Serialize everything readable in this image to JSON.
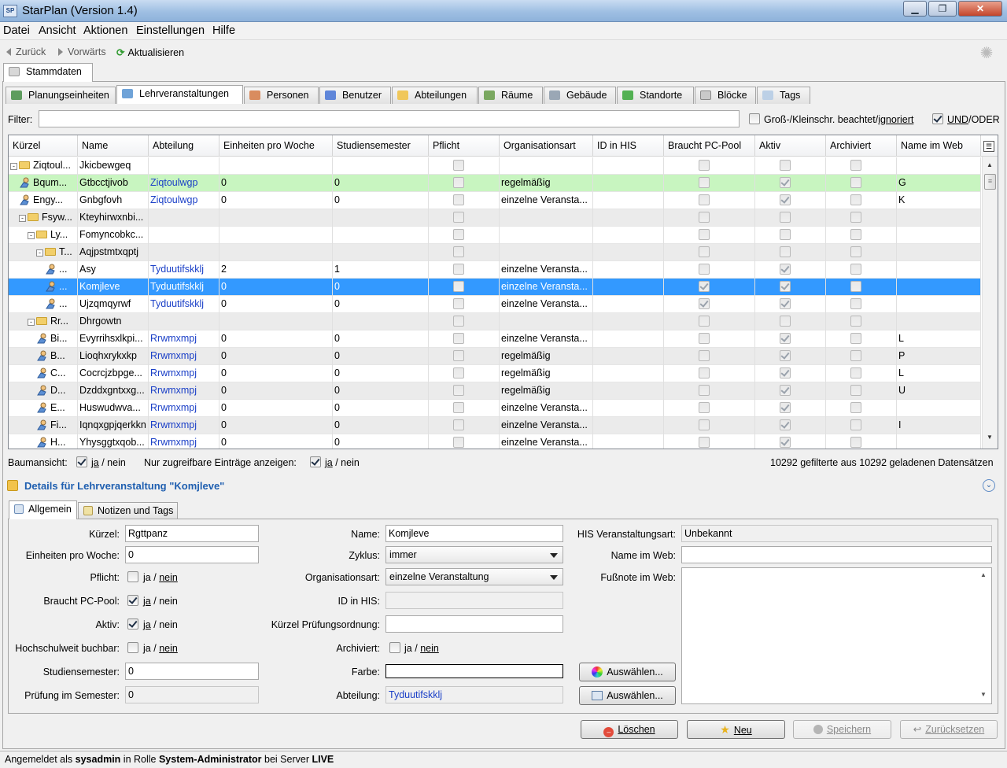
{
  "window": {
    "title": "StarPlan (Version 1.4)",
    "app_icon": "SP"
  },
  "menu": [
    "Datei",
    "Ansicht",
    "Aktionen",
    "Einstellungen",
    "Hilfe"
  ],
  "nav": {
    "back": "Zurück",
    "forward": "Vorwärts",
    "refresh": "Aktualisieren"
  },
  "outer_tab": "Stammdaten",
  "tabs": [
    "Planungseinheiten",
    "Lehrveranstaltungen",
    "Personen",
    "Benutzer",
    "Abteilungen",
    "Räume",
    "Gebäude",
    "Standorte",
    "Blöcke",
    "Tags"
  ],
  "filter": {
    "label": "Filter:",
    "value": "",
    "case_label": "Groß-/Kleinschr. beachtet/",
    "case_link": "ignoriert",
    "and_label": "UND",
    "or_label": "/ODER"
  },
  "grid": {
    "columns": [
      "Kürzel",
      "Name",
      "Abteilung",
      "Einheiten pro Woche",
      "Studiensemester",
      "Pflicht",
      "Organisationsart",
      "ID in HIS",
      "Braucht PC-Pool",
      "Aktiv",
      "Archiviert",
      "Name im Web"
    ],
    "rows": [
      {
        "indent": 0,
        "type": "folder",
        "exp": "-",
        "k": "Ziqtoul...",
        "n": "Jkicbewgeq",
        "a": "",
        "e": "",
        "s": "",
        "o": "",
        "pc": false,
        "ak": false,
        "w": "",
        "bg": "white"
      },
      {
        "indent": 1,
        "type": "item",
        "k": "Bqum...",
        "n": "Gtbcctjivob",
        "a": "Ziqtoulwgp",
        "e": "0",
        "s": "0",
        "o": "regelmäßig",
        "pc": false,
        "ak": true,
        "w": "G",
        "bg": "green"
      },
      {
        "indent": 1,
        "type": "item",
        "k": "Engy...",
        "n": "Gnbgfovh",
        "a": "Ziqtoulwgp",
        "e": "0",
        "s": "0",
        "o": "einzelne Veransta...",
        "pc": false,
        "ak": true,
        "w": "K",
        "bg": "white"
      },
      {
        "indent": 1,
        "type": "folder",
        "exp": "-",
        "k": "Fsyw...",
        "n": "Kteyhirwxnbi...",
        "a": "",
        "e": "",
        "s": "",
        "o": "",
        "pc": false,
        "ak": false,
        "w": "",
        "bg": "gray"
      },
      {
        "indent": 2,
        "type": "folder",
        "exp": "-",
        "k": "Ly...",
        "n": "Fomyncobkc...",
        "a": "",
        "e": "",
        "s": "",
        "o": "",
        "pc": false,
        "ak": false,
        "w": "",
        "bg": "white"
      },
      {
        "indent": 3,
        "type": "folder",
        "exp": "-",
        "k": "T...",
        "n": "Aqjpstmtxqptj",
        "a": "",
        "e": "",
        "s": "",
        "o": "",
        "pc": false,
        "ak": false,
        "w": "",
        "bg": "gray"
      },
      {
        "indent": 4,
        "type": "item",
        "k": "...",
        "n": "Asy",
        "a": "Tyduutifskklj",
        "e": "2",
        "s": "1",
        "o": "einzelne Veransta...",
        "pc": false,
        "ak": true,
        "w": "",
        "bg": "white"
      },
      {
        "indent": 4,
        "type": "item",
        "k": "...",
        "n": "Komjleve",
        "a": "Tyduutifskklj",
        "e": "0",
        "s": "0",
        "o": "einzelne Veransta...",
        "pc": true,
        "ak": true,
        "w": "",
        "bg": "sel"
      },
      {
        "indent": 4,
        "type": "item",
        "k": "...",
        "n": "Ujzqmqyrwf",
        "a": "Tyduutifskklj",
        "e": "0",
        "s": "0",
        "o": "einzelne Veransta...",
        "pc": true,
        "ak": true,
        "w": "",
        "bg": "white"
      },
      {
        "indent": 2,
        "type": "folder",
        "exp": "-",
        "k": "Rr...",
        "n": "Dhrgowtn",
        "a": "",
        "e": "",
        "s": "",
        "o": "",
        "pc": false,
        "ak": false,
        "w": "",
        "bg": "gray"
      },
      {
        "indent": 3,
        "type": "item",
        "k": "Bi...",
        "n": "Evyrrihsxlkpi...",
        "a": "Rrwmxmpj",
        "e": "0",
        "s": "0",
        "o": "einzelne Veransta...",
        "pc": false,
        "ak": true,
        "w": "L",
        "bg": "white"
      },
      {
        "indent": 3,
        "type": "item",
        "k": "B...",
        "n": "Lioqhxrykxkp",
        "a": "Rrwmxmpj",
        "e": "0",
        "s": "0",
        "o": "regelmäßig",
        "pc": false,
        "ak": true,
        "w": "P",
        "bg": "gray"
      },
      {
        "indent": 3,
        "type": "item",
        "k": "C...",
        "n": "Cocrcjzbpge...",
        "a": "Rrwmxmpj",
        "e": "0",
        "s": "0",
        "o": "regelmäßig",
        "pc": false,
        "ak": true,
        "w": "L",
        "bg": "white"
      },
      {
        "indent": 3,
        "type": "item",
        "k": "D...",
        "n": "Dzddxgntxxg...",
        "a": "Rrwmxmpj",
        "e": "0",
        "s": "0",
        "o": "regelmäßig",
        "pc": false,
        "ak": true,
        "w": "U",
        "bg": "gray"
      },
      {
        "indent": 3,
        "type": "item",
        "k": "E...",
        "n": "Huswudwva...",
        "a": "Rrwmxmpj",
        "e": "0",
        "s": "0",
        "o": "einzelne Veransta...",
        "pc": false,
        "ak": true,
        "w": "",
        "bg": "white"
      },
      {
        "indent": 3,
        "type": "item",
        "k": "Fi...",
        "n": "Iqnqxgpjqerkkn",
        "a": "Rrwmxmpj",
        "e": "0",
        "s": "0",
        "o": "einzelne Veransta...",
        "pc": false,
        "ak": true,
        "w": "I",
        "bg": "gray"
      },
      {
        "indent": 3,
        "type": "item",
        "k": "H...",
        "n": "Yhysggtxqob...",
        "a": "Rrwmxmpj",
        "e": "0",
        "s": "0",
        "o": "einzelne Veransta...",
        "pc": false,
        "ak": true,
        "w": "",
        "bg": "white"
      }
    ]
  },
  "options": {
    "tree_label": "Baumansicht:",
    "only_label": "Nur zugreifbare Einträge anzeigen:",
    "ja": "ja",
    "nein": "/ nein",
    "count": "10292 gefilterte aus 10292 geladenen Datensätzen"
  },
  "details": {
    "title": "Details für Lehrveranstaltung \"Komjleve\"",
    "tabs": [
      "Allgemein",
      "Notizen und Tags"
    ]
  },
  "form": {
    "kuerzel_l": "Kürzel:",
    "kuerzel_v": "Rgttpanz",
    "einh_l": "Einheiten pro Woche:",
    "einh_v": "0",
    "pflicht_l": "Pflicht:",
    "pc_l": "Braucht PC-Pool:",
    "aktiv_l": "Aktiv:",
    "hoch_l": "Hochschulweit buchbar:",
    "studsem_l": "Studiensemester:",
    "studsem_v": "0",
    "pruef_l": "Prüfung im Semester:",
    "pruef_v": "0",
    "name_l": "Name:",
    "name_v": "Komjleve",
    "zyklus_l": "Zyklus:",
    "zyklus_v": "immer",
    "org_l": "Organisationsart:",
    "org_v": "einzelne Veranstaltung",
    "his_l": "ID in HIS:",
    "his_v": "",
    "kpo_l": "Kürzel Prüfungsordnung:",
    "kpo_v": "",
    "arch_l": "Archiviert:",
    "farbe_l": "Farbe:",
    "farbe_v": "",
    "abt_l": "Abteilung:",
    "abt_v": "Tyduutifskklj",
    "auswahl": "Auswählen...",
    "hisart_l": "HIS Veranstaltungsart:",
    "hisart_v": "Unbekannt",
    "web_l": "Name im Web:",
    "web_v": "",
    "fuss_l": "Fußnote im Web:",
    "ja": "ja",
    "sep": "/",
    "nein": "nein"
  },
  "buttons": {
    "delete": "Löschen",
    "new": "Neu",
    "save": "Speichern",
    "reset": "Zurücksetzen"
  },
  "status": {
    "prefix": "Angemeldet als ",
    "user": "sysadmin",
    "mid": " in Rolle ",
    "role": "System-Administrator",
    "mid2": " bei Server ",
    "server": "LIVE"
  }
}
